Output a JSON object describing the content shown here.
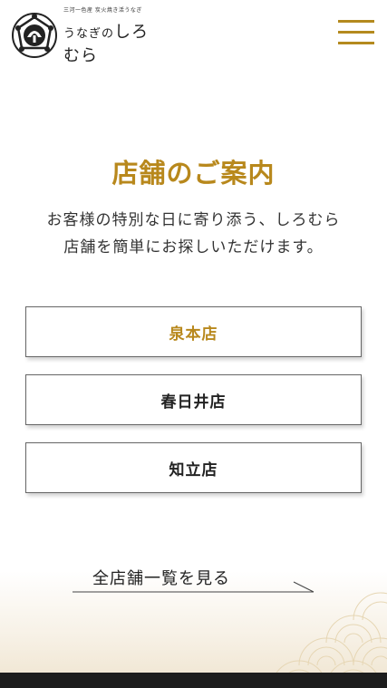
{
  "header": {
    "logo_tagline": "三河一色産 炭火焼き活うなぎ",
    "logo_name_prefix": "うなぎの",
    "logo_name_main": "しろむら"
  },
  "main": {
    "title": "店舗のご案内",
    "description_line1": "お客様の特別な日に寄り添う、しろむら",
    "description_line2": "店舗を簡単にお探しいただけます。",
    "stores": [
      {
        "label": "泉本店"
      },
      {
        "label": "春日井店"
      },
      {
        "label": "知立店"
      }
    ],
    "all_stores_label": "全店舗一覧を見る"
  },
  "colors": {
    "accent": "#b8881c",
    "menu": "#b48a1e",
    "text": "#333333"
  },
  "icons": [
    "logo-emblem-icon",
    "menu-icon",
    "arrow-right-icon"
  ]
}
